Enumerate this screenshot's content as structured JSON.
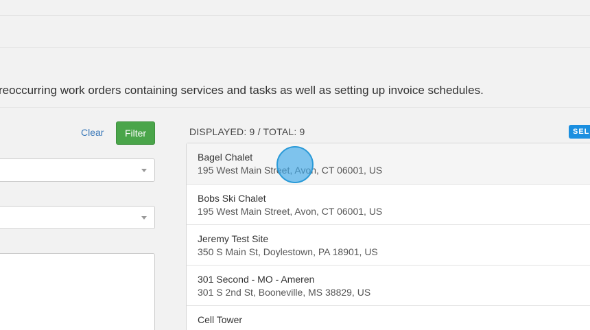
{
  "description": "reoccurring work orders containing services and tasks as well as setting up invoice schedules.",
  "filter_panel": {
    "clear_label": "Clear",
    "filter_label": "Filter"
  },
  "list_panel": {
    "count_label": "DISPLAYED: 9 / TOTAL: 9",
    "select_badge_label": "SEL",
    "items": [
      {
        "name": "Bagel Chalet",
        "address": "195 West Main Street, Avon, CT 06001, US"
      },
      {
        "name": "Bobs Ski Chalet",
        "address": "195 West Main Street, Avon, CT 06001, US"
      },
      {
        "name": "Jeremy Test Site",
        "address": "350 S Main St, Doylestown, PA 18901, US"
      },
      {
        "name": "301 Second - MO - Ameren",
        "address": "301 S 2nd St, Booneville, MS 38829, US"
      },
      {
        "name": "Cell Tower",
        "address": ""
      }
    ]
  },
  "colors": {
    "filter_button": "#4aa54a",
    "link": "#3a78b8",
    "select_badge": "#1b8fe0",
    "cursor_indicator": "#3da8e8"
  }
}
